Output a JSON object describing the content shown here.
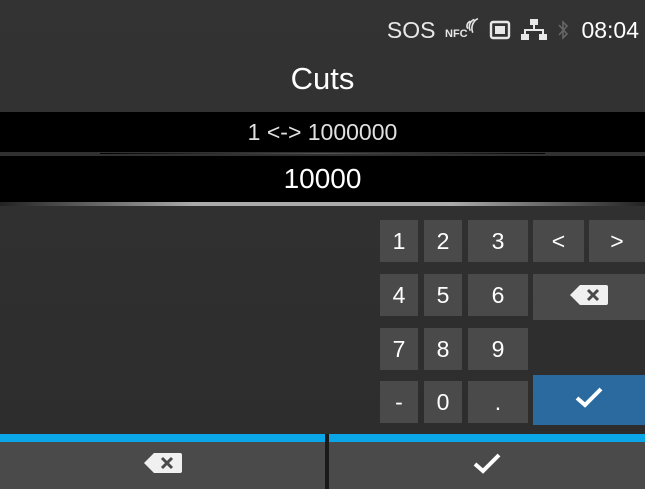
{
  "status_bar": {
    "sos_label": "SOS",
    "nfc_label": "NFC",
    "time": "08:04",
    "icons": [
      "nfc-icon",
      "sd-card-icon",
      "network-icon",
      "bluetooth-icon"
    ]
  },
  "title": "Cuts",
  "range_text": "1 <-> 1000000",
  "value": "10000",
  "keypad": {
    "row1": [
      "1",
      "2",
      "3",
      "<",
      ">"
    ],
    "row2": [
      "4",
      "5",
      "6"
    ],
    "row3": [
      "7",
      "8",
      "9"
    ],
    "row4": [
      "-",
      "0",
      "."
    ]
  },
  "colors": {
    "accent_blue": "#0aa6e8",
    "ok_button": "#2b6a9e",
    "key_bg": "#4a4a4a"
  }
}
